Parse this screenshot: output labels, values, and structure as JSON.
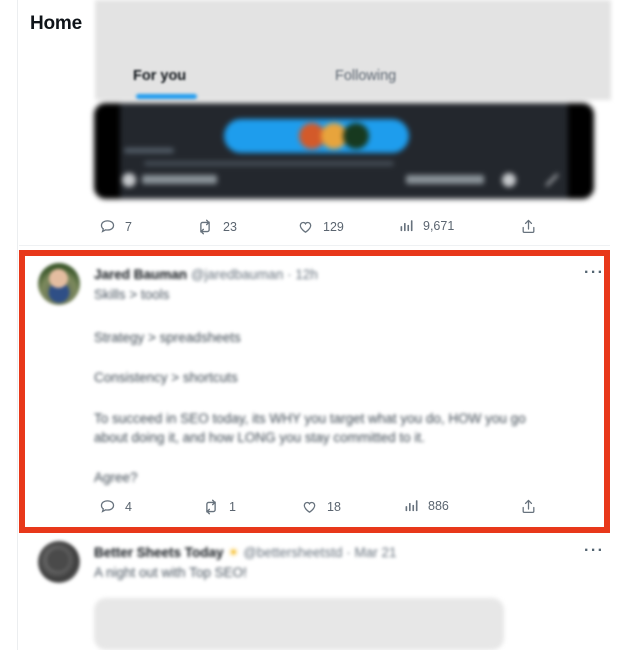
{
  "header": {
    "title": "Home"
  },
  "tabs": [
    {
      "label": "For you",
      "active": true
    },
    {
      "label": "Following",
      "active": false
    }
  ],
  "colors": {
    "accent_blue": "#1d9bf0",
    "annotation_red": "#e8381a",
    "text_primary": "#0f1419",
    "text_secondary": "#67727d",
    "tabbar_bg": "#e3e3e3",
    "video_bg": "#15181c"
  },
  "tweets": [
    {
      "id": "tweet-video",
      "has_media": true,
      "media_type": "video",
      "highlighted": false,
      "actions": {
        "reply_count": "7",
        "retweet_count": "23",
        "like_count": "129",
        "view_count": "9,671",
        "share": ""
      }
    },
    {
      "id": "tweet-jared-bauman",
      "highlighted": true,
      "author": {
        "name": "Jared Bauman",
        "handle": "@jaredbauman",
        "separator": "·",
        "timestamp": "12h",
        "bio_line": "Skills > tools"
      },
      "body": [
        "Strategy > spreadsheets",
        "Consistency > shortcuts",
        "To succeed in SEO today, its WHY you target what you do, HOW you go",
        "about doing it, and how LONG you stay committed to it.",
        "Agree?"
      ],
      "more_menu": "···",
      "actions": {
        "reply_count": "4",
        "retweet_count": "1",
        "like_count": "18",
        "view_count": "886",
        "share": ""
      }
    },
    {
      "id": "tweet-better-sheets",
      "highlighted": false,
      "has_media": true,
      "media_type": "image",
      "author": {
        "name": "Better Sheets Today",
        "emoji": "☀",
        "handle": "@bettersheetstd",
        "separator": "·",
        "timestamp": "Mar 21",
        "bio_line": "A night out with Top SEO!"
      },
      "more_menu": "···"
    }
  ]
}
